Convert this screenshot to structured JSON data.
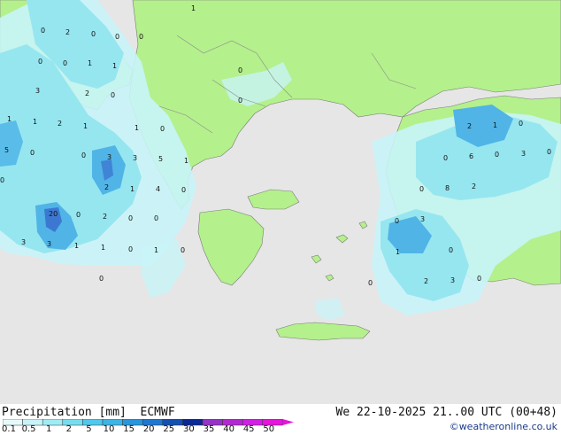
{
  "title": "Precipitation [mm]  ECMWF",
  "datetime": "We 22-10-2025 21..00 UTC (00+48)",
  "credit": "©weatheronline.co.uk",
  "colors": {
    "sea": "#e6e6e6",
    "land": "#b4f08c",
    "precip_light": "#c8f4f8",
    "precip_mid": "#96e6f0",
    "precip_heavy": "#50b4e6",
    "precip_max": "#3c78d2"
  },
  "legend": {
    "labels": [
      "0.1",
      "0.5",
      "1",
      "2",
      "5",
      "10",
      "15",
      "20",
      "25",
      "30",
      "35",
      "40",
      "45",
      "50"
    ],
    "colors": [
      "#e6fafa",
      "#c8f4f8",
      "#a0ecf4",
      "#78dcf0",
      "#50c8ec",
      "#3cb4e6",
      "#2896dc",
      "#1e78d2",
      "#1450b4",
      "#0a2896",
      "#9632c8",
      "#b428d2",
      "#d21ee6",
      "#e614dc"
    ]
  },
  "map_labels": [
    {
      "text": "1"
    },
    {
      "text": "0"
    },
    {
      "text": "2"
    },
    {
      "text": "0"
    },
    {
      "text": "0"
    },
    {
      "text": "0"
    },
    {
      "text": "0"
    },
    {
      "text": "0"
    },
    {
      "text": "1"
    },
    {
      "text": "1"
    },
    {
      "text": "0"
    },
    {
      "text": "3"
    },
    {
      "text": "2"
    },
    {
      "text": "0"
    },
    {
      "text": "0"
    },
    {
      "text": "1"
    },
    {
      "text": "1"
    },
    {
      "text": "2"
    },
    {
      "text": "1"
    },
    {
      "text": "1"
    },
    {
      "text": "0"
    },
    {
      "text": "5"
    },
    {
      "text": "0"
    },
    {
      "text": "0"
    },
    {
      "text": "3"
    },
    {
      "text": "3"
    },
    {
      "text": "5"
    },
    {
      "text": "1"
    },
    {
      "text": "0"
    },
    {
      "text": "2"
    },
    {
      "text": "1"
    },
    {
      "text": "4"
    },
    {
      "text": "0"
    },
    {
      "text": "20"
    },
    {
      "text": "0"
    },
    {
      "text": "2"
    },
    {
      "text": "0"
    },
    {
      "text": "0"
    },
    {
      "text": "3"
    },
    {
      "text": "3"
    },
    {
      "text": "1"
    },
    {
      "text": "1"
    },
    {
      "text": "0"
    },
    {
      "text": "1"
    },
    {
      "text": "0"
    },
    {
      "text": "0"
    },
    {
      "text": "2"
    },
    {
      "text": "1"
    },
    {
      "text": "0"
    },
    {
      "text": "0"
    },
    {
      "text": "6"
    },
    {
      "text": "0"
    },
    {
      "text": "3"
    },
    {
      "text": "0"
    },
    {
      "text": "0"
    },
    {
      "text": "8"
    },
    {
      "text": "2"
    },
    {
      "text": "0"
    },
    {
      "text": "3"
    },
    {
      "text": "1"
    },
    {
      "text": "0"
    },
    {
      "text": "2"
    },
    {
      "text": "3"
    },
    {
      "text": "0"
    },
    {
      "text": "0"
    }
  ]
}
